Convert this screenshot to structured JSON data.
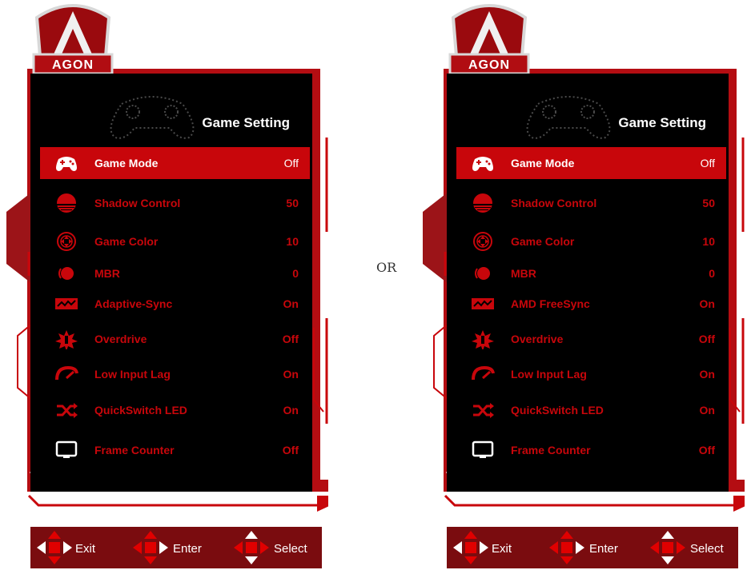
{
  "brand": "AGON",
  "separator_label": "OR",
  "colors": {
    "accent": "#c8060b",
    "dark_red": "#7a0c0f",
    "screen_bg": "#000000"
  },
  "panels": [
    {
      "title": "Game Setting",
      "items": [
        {
          "label": "Game Mode",
          "value": "Off",
          "icon": "gamepad-icon",
          "selected": true
        },
        {
          "label": "Shadow Control",
          "value": "50",
          "icon": "shadow-control-icon"
        },
        {
          "label": "Game Color",
          "value": "10",
          "icon": "game-color-icon"
        },
        {
          "label": "MBR",
          "value": "0",
          "icon": "mbr-icon"
        },
        {
          "label": "Adaptive-Sync",
          "value": "On",
          "icon": "adaptive-sync-icon"
        },
        {
          "label": "Overdrive",
          "value": "Off",
          "icon": "overdrive-icon"
        },
        {
          "label": "Low Input Lag",
          "value": "On",
          "icon": "speedometer-icon"
        },
        {
          "label": "QuickSwitch LED",
          "value": "On",
          "icon": "shuffle-icon"
        },
        {
          "label": "Frame Counter",
          "value": "Off",
          "icon": "monitor-icon"
        }
      ],
      "nav": {
        "exit": "Exit",
        "enter": "Enter",
        "select": "Select"
      }
    },
    {
      "title": "Game Setting",
      "items": [
        {
          "label": "Game Mode",
          "value": "Off",
          "icon": "gamepad-icon",
          "selected": true
        },
        {
          "label": "Shadow Control",
          "value": "50",
          "icon": "shadow-control-icon"
        },
        {
          "label": "Game Color",
          "value": "10",
          "icon": "game-color-icon"
        },
        {
          "label": "MBR",
          "value": "0",
          "icon": "mbr-icon"
        },
        {
          "label": "AMD FreeSync",
          "value": "On",
          "icon": "adaptive-sync-icon"
        },
        {
          "label": "Overdrive",
          "value": "Off",
          "icon": "overdrive-icon"
        },
        {
          "label": "Low Input Lag",
          "value": "On",
          "icon": "speedometer-icon"
        },
        {
          "label": "QuickSwitch LED",
          "value": "On",
          "icon": "shuffle-icon"
        },
        {
          "label": "Frame Counter",
          "value": "Off",
          "icon": "monitor-icon"
        }
      ],
      "nav": {
        "exit": "Exit",
        "enter": "Enter",
        "select": "Select"
      }
    }
  ]
}
